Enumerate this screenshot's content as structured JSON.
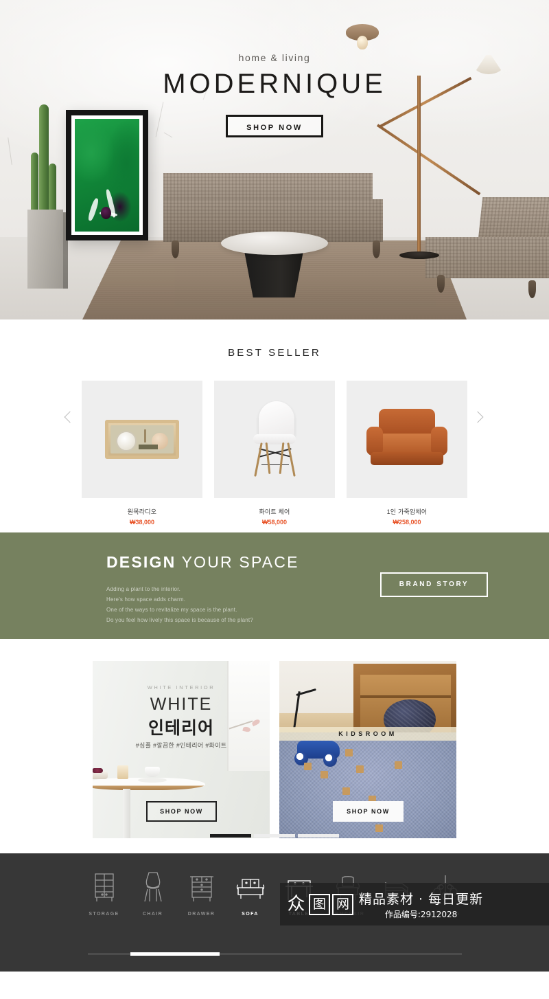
{
  "hero": {
    "kicker": "home & living",
    "title": "MODERNIQUE",
    "cta": "SHOP NOW"
  },
  "best_seller": {
    "title": "BEST SELLER",
    "prev_icon": "chevron-left-icon",
    "next_icon": "chevron-right-icon",
    "products": [
      {
        "name": "원목라디오",
        "price": "₩38,000"
      },
      {
        "name": "화이트 체어",
        "price": "₩58,000"
      },
      {
        "name": "1인 가죽암체어",
        "price": "₩258,000"
      }
    ]
  },
  "design": {
    "heading_bold": "DESIGN",
    "heading_rest": " YOUR SPACE",
    "line1": "Adding a plant to the interior.",
    "line2": "Here's how space adds charm.",
    "line3": "One of the ways to revitalize my space is the plant.",
    "line4": "Do you feel how lively this space is because of the plant?",
    "button": "BRAND STORY",
    "bg_color": "#76815f"
  },
  "promo": {
    "white_card": {
      "kicker": "WHITE INTERIOR",
      "title": "WHITE",
      "subtitle": "인테리어",
      "tags": "#심플 #깔끔한 #인테리어 #화이트",
      "cta": "SHOP NOW"
    },
    "kids_card": {
      "band_label": "KIDSROOM",
      "cta": "SHOP NOW"
    },
    "pager": {
      "count": 3,
      "active_index": 0
    }
  },
  "footer": {
    "categories": [
      {
        "label": "STORAGE",
        "icon": "storage-icon",
        "active": false
      },
      {
        "label": "CHAIR",
        "icon": "chair-icon",
        "active": false
      },
      {
        "label": "DRAWER",
        "icon": "drawer-icon",
        "active": false
      },
      {
        "label": "SOFA",
        "icon": "sofa-icon",
        "active": true
      },
      {
        "label": "TABLE",
        "icon": "table-icon",
        "active": true
      },
      {
        "label": "ARMCHAIR",
        "icon": "armchair-icon",
        "active": false
      },
      {
        "label": "BED",
        "icon": "bed-icon",
        "active": false
      },
      {
        "label": "LIGHTING",
        "icon": "lighting-icon",
        "active": false
      }
    ]
  },
  "watermark": {
    "char1": "众",
    "char2": "图",
    "char3": "网",
    "tagline": "精品素材 · 每日更新",
    "code": "作品编号:2912028"
  }
}
